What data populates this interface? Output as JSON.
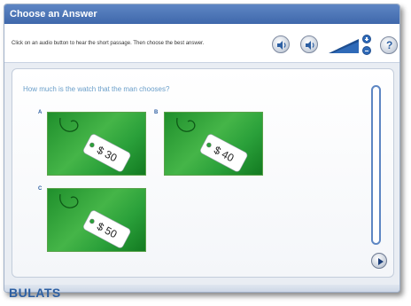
{
  "window": {
    "title": "Choose an Answer"
  },
  "toolbar": {
    "instructions": "Click on an audio button to hear the short passage. Then choose the best answer.",
    "icons": [
      "speaker-icon",
      "speaker-icon",
      "volume-level-icon",
      "plus-icon",
      "minus-icon",
      "help-icon"
    ],
    "help_label": "?"
  },
  "question": {
    "text": "How much is the watch that the man chooses?"
  },
  "options": [
    {
      "letter": "A",
      "price": "$ 30"
    },
    {
      "letter": "B",
      "price": "$ 40"
    },
    {
      "letter": "C",
      "price": "$ 50"
    }
  ],
  "footer": {
    "brand": "BULATS"
  },
  "colors": {
    "accent": "#3f68ab",
    "option_green": "#2aa03a",
    "question_text": "#6a9ec9"
  }
}
